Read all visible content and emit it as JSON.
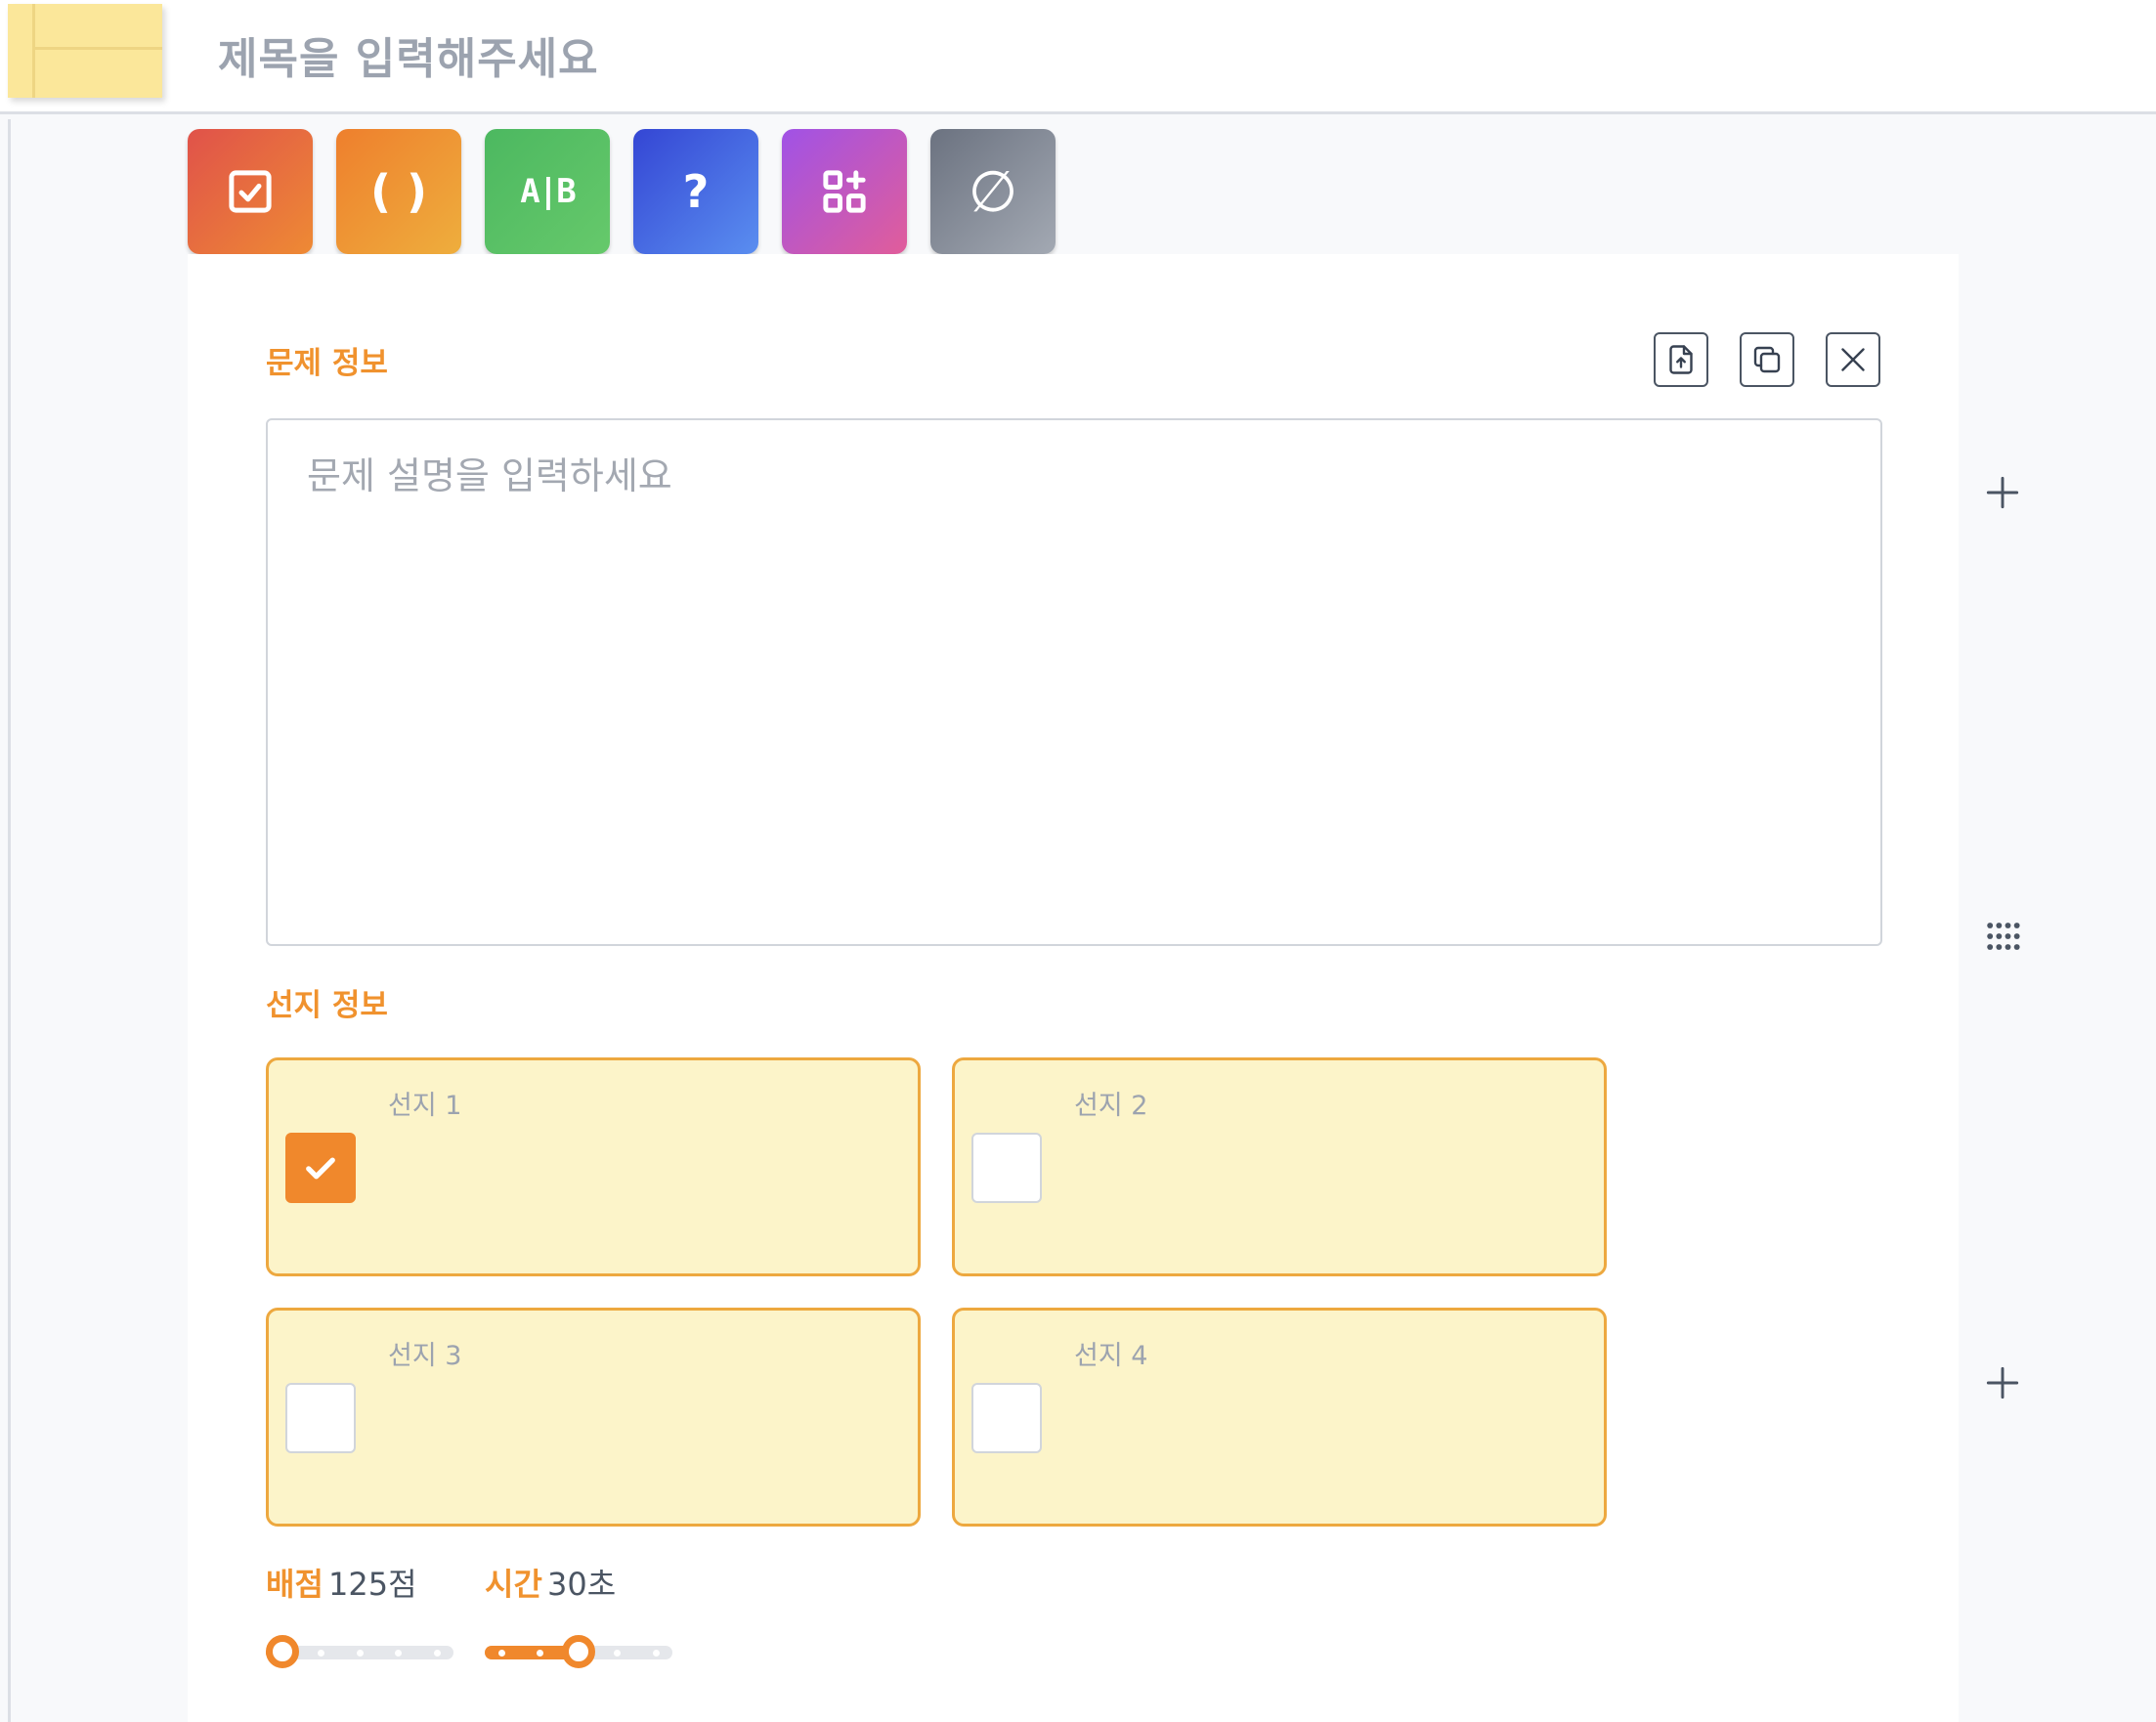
{
  "header": {
    "title": "제목을 입력해주세요"
  },
  "toolbar": {
    "tools": [
      {
        "name": "checkbox-quiz",
        "icon": "check-square-icon",
        "colors": [
          "#e0524a",
          "#ee8a34"
        ]
      },
      {
        "name": "fill-blank",
        "icon": "parentheses-icon",
        "glyph": "( )",
        "colors": [
          "#ee7f2d",
          "#eeae3d"
        ]
      },
      {
        "name": "ox-quiz",
        "icon": "a-b-icon",
        "glyph": "A|B",
        "colors": [
          "#4cb860",
          "#66c96b"
        ]
      },
      {
        "name": "short-answer",
        "icon": "question-icon",
        "glyph": "?",
        "colors": [
          "#3446d4",
          "#5a8ef0"
        ]
      },
      {
        "name": "matching",
        "icon": "apps-add-icon",
        "colors": [
          "#a052e6",
          "#e15d9a"
        ]
      },
      {
        "name": "none",
        "icon": "empty-set-icon",
        "glyph": "∅",
        "colors": [
          "#6b7280",
          "#a3a9b3"
        ]
      }
    ]
  },
  "question": {
    "section_label": "문제 정보",
    "placeholder": "문제 설명을 입력하세요",
    "actions": {
      "upload": "file-upload-icon",
      "copy": "copy-icon",
      "close": "close-icon"
    }
  },
  "choices": {
    "section_label": "선지 정보",
    "items": [
      {
        "label": "선지 1",
        "checked": true
      },
      {
        "label": "선지 2",
        "checked": false
      },
      {
        "label": "선지 3",
        "checked": false
      },
      {
        "label": "선지 4",
        "checked": false
      }
    ]
  },
  "score": {
    "label": "배점",
    "value": "125점",
    "slider_level": 0.0,
    "slider_steps": 5
  },
  "time": {
    "label": "시간",
    "value": "30초",
    "slider_level": 0.5,
    "slider_steps": 5
  },
  "colors": {
    "accent": "#f0922e",
    "choice_bg": "#fcf4c9",
    "choice_border": "#eda83f"
  }
}
